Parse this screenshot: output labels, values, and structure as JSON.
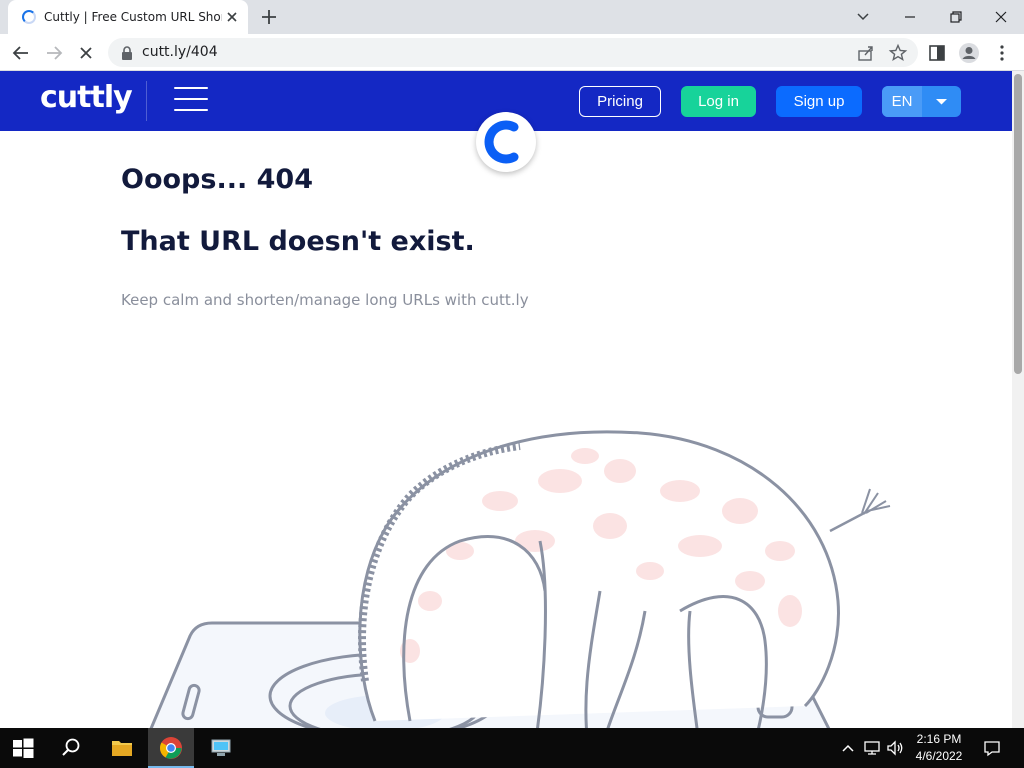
{
  "browser": {
    "tab_title": "Cuttly | Free Custom URL Shortener",
    "url": "cutt.ly/404"
  },
  "site": {
    "logo_text": "cuttly",
    "nav": {
      "pricing_label": "Pricing",
      "login_label": "Log in",
      "signup_label": "Sign up",
      "language_label": "EN"
    },
    "colors": {
      "header_bg": "#1428c4",
      "login_bg": "#17d39a",
      "signup_bg": "#0b6bff",
      "language_bg": "#2f8cf5"
    }
  },
  "content": {
    "heading": "Ooops... 404",
    "subheading": "That URL doesn't exist.",
    "description": "Keep calm and shorten/manage long URLs with cutt.ly"
  },
  "taskbar": {
    "time": "2:16 PM",
    "date": "4/6/2022",
    "icons": [
      "windows-start-icon",
      "search-icon",
      "file-explorer-icon",
      "chrome-icon",
      "network-app-icon"
    ]
  }
}
